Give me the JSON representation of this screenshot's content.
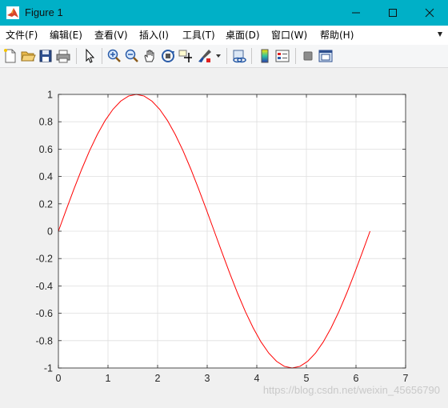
{
  "window": {
    "title": "Figure 1"
  },
  "menu": [
    "文件(F)",
    "编辑(E)",
    "查看(V)",
    "插入(I)",
    "工具(T)",
    "桌面(D)",
    "窗口(W)",
    "帮助(H)"
  ],
  "toolbar_icons": [
    "new-figure-icon",
    "open-file-icon",
    "save-icon",
    "print-icon",
    "pointer-icon",
    "zoom-in-icon",
    "zoom-out-icon",
    "pan-hand-icon",
    "rotate-3d-icon",
    "data-cursor-icon",
    "brush-icon",
    "link-plot-icon",
    "colorbar-icon",
    "legend-icon",
    "hide-plot-tools-icon",
    "show-plot-tools-icon"
  ],
  "watermark": "https://blog.csdn.net/weixin_45656790",
  "chart_data": {
    "type": "line",
    "title": "",
    "xlabel": "",
    "ylabel": "",
    "xlim": [
      0,
      7
    ],
    "ylim": [
      -1,
      1
    ],
    "xticks": [
      "0",
      "1",
      "2",
      "3",
      "4",
      "5",
      "6",
      "7"
    ],
    "yticks": [
      "1",
      "0.8",
      "0.6",
      "0.4",
      "0.2",
      "0",
      "-0.2",
      "-0.4",
      "-0.6",
      "-0.8",
      "-1"
    ],
    "grid": true,
    "series": [
      {
        "color": "#ff0000",
        "x": [
          0,
          0.157,
          0.314,
          0.471,
          0.628,
          0.785,
          0.942,
          1.1,
          1.257,
          1.414,
          1.571,
          1.728,
          1.885,
          2.042,
          2.199,
          2.356,
          2.513,
          2.67,
          2.827,
          2.985,
          3.142,
          3.299,
          3.456,
          3.613,
          3.77,
          3.927,
          4.084,
          4.241,
          4.398,
          4.555,
          4.712,
          4.869,
          5.027,
          5.184,
          5.341,
          5.498,
          5.655,
          5.812,
          5.969,
          6.126,
          6.283
        ],
        "y": [
          0,
          0.156,
          0.309,
          0.454,
          0.588,
          0.707,
          0.809,
          0.891,
          0.951,
          0.988,
          1,
          0.988,
          0.951,
          0.891,
          0.809,
          0.707,
          0.588,
          0.454,
          0.309,
          0.156,
          0,
          -0.156,
          -0.309,
          -0.454,
          -0.588,
          -0.707,
          -0.809,
          -0.891,
          -0.951,
          -0.988,
          -1,
          -0.988,
          -0.951,
          -0.891,
          -0.809,
          -0.707,
          -0.588,
          -0.454,
          -0.309,
          -0.156,
          0
        ]
      }
    ]
  }
}
